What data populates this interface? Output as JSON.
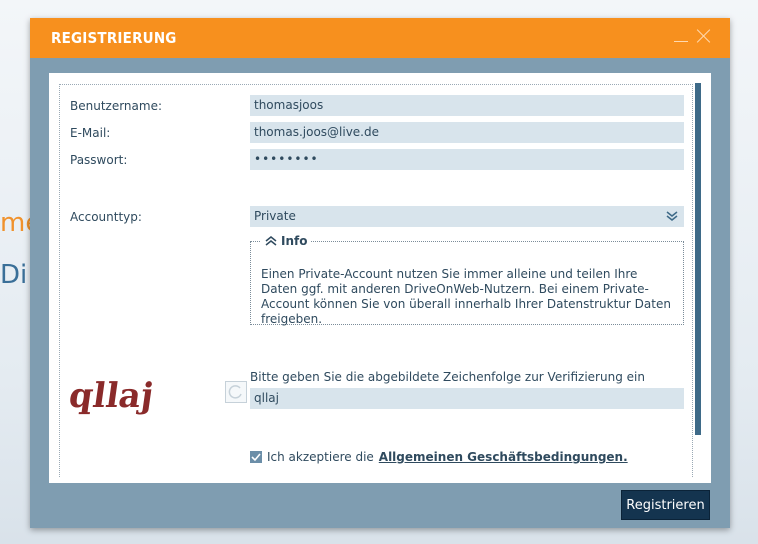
{
  "background": {
    "partial_text_top": "me",
    "partial_text_bottom": "Di"
  },
  "dialog": {
    "title": "REGISTRIERUNG",
    "colors": {
      "titlebar": "#f7901e",
      "frame": "#7f9db1",
      "button": "#14344f",
      "field": "#d8e4ec"
    }
  },
  "form": {
    "username": {
      "label": "Benutzername:",
      "value": "thomasjoos"
    },
    "email": {
      "label": "E-Mail:",
      "value": "thomas.joos@live.de"
    },
    "password": {
      "label": "Passwort:",
      "value": "••••••••"
    },
    "account_type": {
      "label": "Accounttyp:",
      "value": "Private"
    }
  },
  "info": {
    "title": "Info",
    "text": "Einen Private-Account nutzen Sie immer alleine und teilen Ihre Daten ggf. mit anderen DriveOnWeb-Nutzern. Bei einem Private-Account können Sie von überall innerhalb Ihrer Datenstruktur Daten freigeben."
  },
  "captcha": {
    "image_text": "qllaj",
    "hint": "Bitte geben Sie die abgebildete Zeichenfolge zur Verifizierung ein",
    "value": "qllaj"
  },
  "terms": {
    "checked": true,
    "prefix": "Ich akzeptiere die",
    "link": "Allgemeinen Geschäftsbedingungen."
  },
  "actions": {
    "register": "Registrieren"
  }
}
